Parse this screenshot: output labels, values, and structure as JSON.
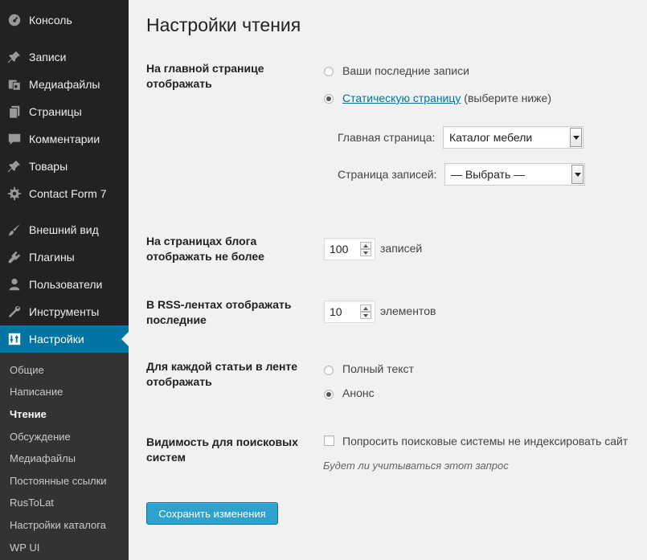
{
  "sidebar": {
    "items": [
      {
        "label": "Консоль",
        "icon": "dashboard-icon"
      },
      {
        "label": "Записи",
        "icon": "pin-icon"
      },
      {
        "label": "Медиафайлы",
        "icon": "media-icon"
      },
      {
        "label": "Страницы",
        "icon": "pages-icon"
      },
      {
        "label": "Комментарии",
        "icon": "comments-icon"
      },
      {
        "label": "Товары",
        "icon": "pin-icon"
      },
      {
        "label": "Contact Form 7",
        "icon": "gear-icon"
      },
      {
        "label": "Внешний вид",
        "icon": "brush-icon"
      },
      {
        "label": "Плагины",
        "icon": "plugin-icon"
      },
      {
        "label": "Пользователи",
        "icon": "user-icon"
      },
      {
        "label": "Инструменты",
        "icon": "wrench-icon"
      },
      {
        "label": "Настройки",
        "icon": "settings-icon"
      }
    ],
    "submenu": [
      "Общие",
      "Написание",
      "Чтение",
      "Обсуждение",
      "Медиафайлы",
      "Постоянные ссылки",
      "RusToLat",
      "Настройки каталога",
      "WP UI"
    ]
  },
  "page": {
    "title": "Настройки чтения",
    "front_page": {
      "label": "На главной странице отображать",
      "option_latest": "Ваши последние записи",
      "option_static_link": "Статическую страницу",
      "option_static_suffix": " (выберите ниже)",
      "home_label": "Главная страница:",
      "home_value": "Каталог мебели",
      "posts_label": "Страница записей:",
      "posts_value": "— Выбрать —"
    },
    "posts_per_page": {
      "label": "На страницах блога отображать не более",
      "value": "100",
      "unit": "записей"
    },
    "rss_count": {
      "label": "В RSS-лентах отображать последние",
      "value": "10",
      "unit": "элементов"
    },
    "feed_display": {
      "label": "Для каждой статьи в ленте отображать",
      "option_full": "Полный текст",
      "option_summary": "Анонс"
    },
    "search_visibility": {
      "label": "Видимость для поисковых систем",
      "checkbox_label": "Попросить поисковые системы не индексировать сайт",
      "description": "Будет ли учитываться этот запрос"
    },
    "save_button": "Сохранить изменения"
  },
  "colors": {
    "sidebar_bg": "#222222",
    "active_menu": "#0074a2",
    "button": "#2ea2cc",
    "link": "#0074a2"
  }
}
